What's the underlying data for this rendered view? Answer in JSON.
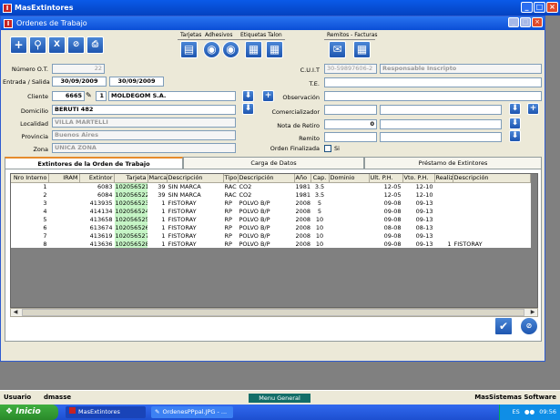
{
  "app": {
    "title": "MasExtintores",
    "icon_letter": "I"
  },
  "window": {
    "title": "Ordenes de Trabajo",
    "icon_letter": "I"
  },
  "toolbar": {
    "groups": [
      {
        "label": "Tarjetas",
        "id": "tarjetas"
      },
      {
        "label": "Adhesivos",
        "id": "adhesivos"
      },
      {
        "label": "Etiquetas Talon",
        "id": "etiquetas"
      },
      {
        "label": "Remitos - Facturas",
        "id": "remitos"
      }
    ]
  },
  "form": {
    "numero_ot": {
      "label": "Número O.T.",
      "value": "22"
    },
    "entrada_salida": {
      "label": "Entrada / Salida",
      "entrada": "30/09/2009",
      "salida": "30/09/2009"
    },
    "cliente": {
      "label": "Cliente",
      "code": "6665",
      "suffix": "1",
      "name": "MOLDEGOM S.A."
    },
    "domicilio": {
      "label": "Domicilio",
      "value": "BERUTI 482"
    },
    "localidad": {
      "label": "Localidad",
      "value": "VILLA MARTELLI"
    },
    "provincia": {
      "label": "Provincia",
      "value": "Buenos Aires"
    },
    "zona": {
      "label": "Zona",
      "value": "UNICA ZONA"
    },
    "cuit": {
      "label": "C.U.I.T",
      "value": "30-59897606-2",
      "condicion": "Responsable Inscripto"
    },
    "te": {
      "label": "T.E.",
      "value": ""
    },
    "observacion": {
      "label": "Observación",
      "value": ""
    },
    "comercializador": {
      "label": "Comercializador",
      "value": ""
    },
    "nota_retiro": {
      "label": "Nota de Retiro",
      "value": "0"
    },
    "remito": {
      "label": "Remito",
      "value": ""
    },
    "orden_finalizada": {
      "label": "Orden Finalizada",
      "option": "Si",
      "checked": false
    }
  },
  "tabs": [
    {
      "label": "Extintores de la Orden de Trabajo",
      "active": true
    },
    {
      "label": "Carga de Datos",
      "active": false
    },
    {
      "label": "Préstamo de Extintores",
      "active": false
    }
  ],
  "grid": {
    "columns": [
      "Nro Interno",
      "IRAM",
      "Extintor",
      "Tarjeta",
      "Marca",
      "Descripción",
      "Tipo",
      "Descripción",
      "Año",
      "Cap.",
      "Dominio",
      "Ult. P.H.",
      "Vto. P.H.",
      "Realiz.",
      "Descripción"
    ],
    "rows": [
      [
        "1",
        "",
        "6083",
        "102056521",
        "39",
        "SIN MARCA",
        "RAC",
        "CO2",
        "1981",
        "3.5",
        "",
        "12-05",
        "12-10",
        "",
        ""
      ],
      [
        "2",
        "",
        "6084",
        "102056522",
        "39",
        "SIN MARCA",
        "RAC",
        "CO2",
        "1981",
        "3.5",
        "",
        "12-05",
        "12-10",
        "",
        ""
      ],
      [
        "3",
        "",
        "413935",
        "102056523",
        "1",
        "FISTORAY",
        "RP",
        "POLVO B/P",
        "2008",
        "5",
        "",
        "09-08",
        "09-13",
        "",
        ""
      ],
      [
        "4",
        "",
        "414134",
        "102056524",
        "1",
        "FISTORAY",
        "RP",
        "POLVO B/P",
        "2008",
        "5",
        "",
        "09-08",
        "09-13",
        "",
        ""
      ],
      [
        "5",
        "",
        "413658",
        "102056525",
        "1",
        "FISTORAY",
        "RP",
        "POLVO B/P",
        "2008",
        "10",
        "",
        "09-08",
        "09-13",
        "",
        ""
      ],
      [
        "6",
        "",
        "613674",
        "102056526",
        "1",
        "FISTORAY",
        "RP",
        "POLVO B/P",
        "2008",
        "10",
        "",
        "08-08",
        "08-13",
        "",
        ""
      ],
      [
        "7",
        "",
        "413619",
        "102056527",
        "1",
        "FISTORAY",
        "RP",
        "POLVO B/P",
        "2008",
        "10",
        "",
        "09-08",
        "09-13",
        "",
        ""
      ],
      [
        "8",
        "",
        "413636",
        "102056528",
        "1",
        "FISTORAY",
        "RP",
        "POLVO B/P",
        "2008",
        "10",
        "",
        "09-08",
        "09-13",
        "1",
        "FISTORAY"
      ]
    ]
  },
  "statusbar": {
    "user_label": "Usuario",
    "user": "dmasse",
    "menu": "Menu General",
    "company": "MasSistemas Software"
  },
  "taskbar": {
    "start": "Inicio",
    "items": [
      "MasExtintores",
      "OrdenesPPpal.JPG - ..."
    ],
    "lang": "ES",
    "time": "09:56"
  }
}
